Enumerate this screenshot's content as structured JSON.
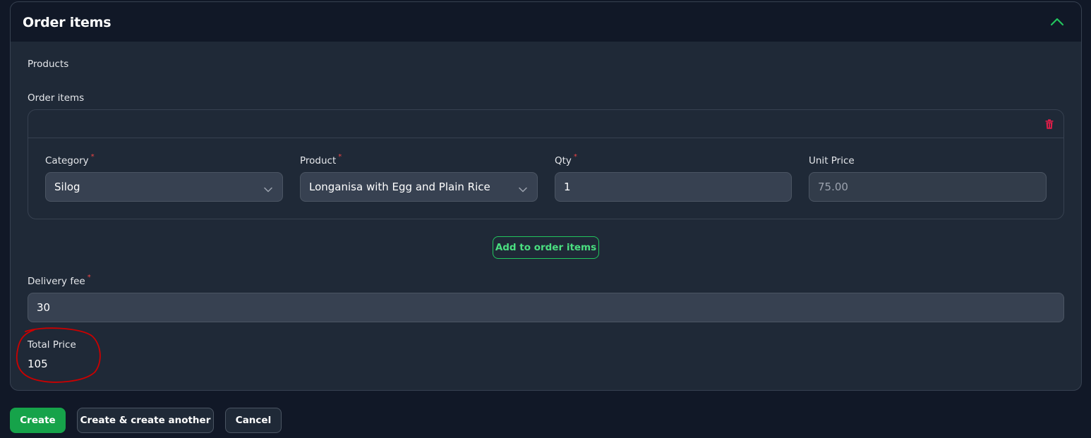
{
  "section": {
    "title": "Order items"
  },
  "form": {
    "products_label": "Products",
    "order_items_label": "Order items",
    "item": {
      "category": {
        "label": "Category",
        "value": "Silog"
      },
      "product": {
        "label": "Product",
        "value": "Longanisa with Egg and Plain Rice"
      },
      "qty": {
        "label": "Qty",
        "value": "1"
      },
      "unit_price": {
        "label": "Unit Price",
        "value": "75.00"
      }
    },
    "required_mark": "*",
    "add_button": "Add to order items",
    "delivery_fee": {
      "label": "Delivery fee",
      "value": "30"
    },
    "total_price": {
      "label": "Total Price",
      "value": "105"
    }
  },
  "actions": {
    "create": "Create",
    "create_another": "Create & create another",
    "cancel": "Cancel"
  },
  "colors": {
    "accent": "#22c55e",
    "danger": "#ef4444",
    "annotation": "#cc0000"
  },
  "icons": {
    "collapse": "chevron-up-icon",
    "delete": "trash-icon",
    "select": "chevron-down-icon"
  }
}
